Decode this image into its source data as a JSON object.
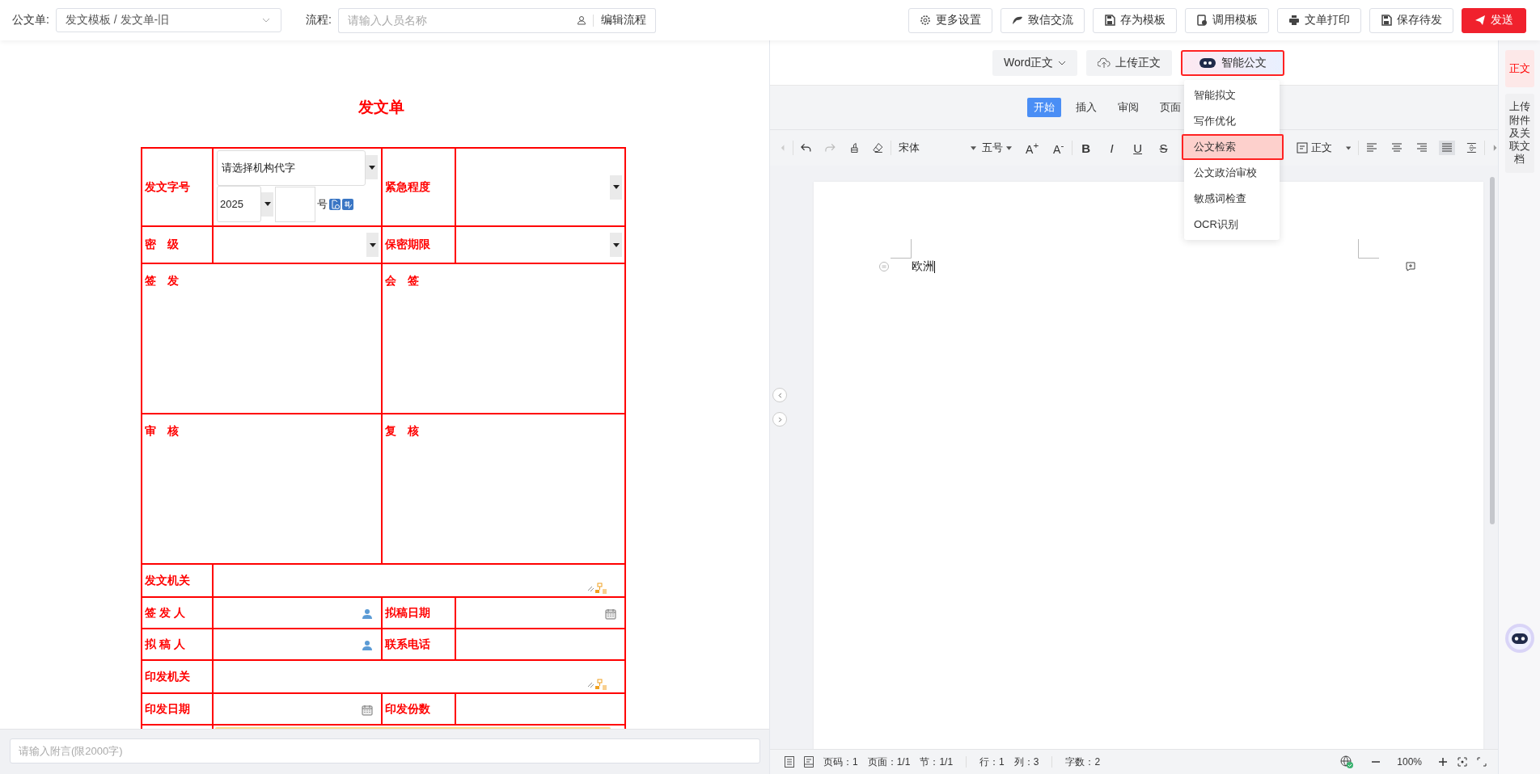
{
  "header": {
    "form_label": "公文单:",
    "form_select": "发文模板 / 发文单-旧",
    "flow_label": "流程:",
    "flow_placeholder": "请输入人员名称",
    "flow_button": "编辑流程",
    "actions": [
      {
        "label": "更多设置",
        "kind": "settings",
        "primary": false
      },
      {
        "label": "致信交流",
        "kind": "chat",
        "primary": false
      },
      {
        "label": "存为模板",
        "kind": "save",
        "primary": false
      },
      {
        "label": "调用模板",
        "kind": "template",
        "primary": false
      },
      {
        "label": "文单打印",
        "kind": "print",
        "primary": false
      },
      {
        "label": "保存待发",
        "kind": "save",
        "primary": false
      },
      {
        "label": "发送",
        "kind": "send",
        "primary": true
      }
    ]
  },
  "form": {
    "title": "发文单",
    "doc_number": {
      "label": "发文字号",
      "org_placeholder": "请选择机构代字",
      "year": "2025",
      "suffix": "号"
    },
    "urgency": {
      "label": "紧急程度"
    },
    "secrecy": {
      "label": "密　级"
    },
    "secrecy_term": {
      "label": "保密期限"
    },
    "opinions": [
      [
        {
          "label": "签　发"
        },
        {
          "label": "会　签"
        }
      ],
      [
        {
          "label": "审　核"
        },
        {
          "label": "复　核"
        }
      ]
    ],
    "rows": [
      {
        "kind": "wide",
        "label": "发文机关"
      },
      {
        "kind": "pair",
        "cells": [
          {
            "label": "签 发 人",
            "kind": "person"
          },
          {
            "label": "拟稿日期",
            "kind": "date"
          }
        ]
      },
      {
        "kind": "pair",
        "cells": [
          {
            "label": "拟 稿 人",
            "kind": "person"
          },
          {
            "label": "联系电话",
            "kind": "text"
          }
        ]
      },
      {
        "kind": "wide",
        "label": "印发机关"
      },
      {
        "kind": "pair",
        "cells": [
          {
            "label": "印发日期",
            "kind": "date"
          },
          {
            "label": "印发份数",
            "kind": "text"
          }
        ]
      }
    ]
  },
  "memo": {
    "placeholder": "请输入附言(限2000字)"
  },
  "editor": {
    "top_buttons": [
      {
        "label": "Word正文",
        "kind": "dropdown",
        "highlighted": false
      },
      {
        "label": "上传正文",
        "kind": "upload",
        "highlighted": false
      },
      {
        "label": "智能公文",
        "kind": "ai",
        "highlighted": true
      }
    ],
    "ribbon_tabs": [
      {
        "label": "开始",
        "selected": true
      },
      {
        "label": "插入",
        "selected": false
      },
      {
        "label": "审阅",
        "selected": false
      },
      {
        "label": "页面",
        "selected": false
      }
    ],
    "toolbar": {
      "font": "宋体",
      "size": "五号",
      "size_buttons": [
        "A$^{+}$",
        "A$^{-}$"
      ],
      "format_buttons": [
        {
          "label": "B",
          "kind": "bold"
        },
        {
          "label": "I",
          "kind": "italic"
        },
        {
          "label": "U",
          "kind": "underline"
        },
        {
          "label": "S",
          "kind": "strike"
        }
      ],
      "style": "正文",
      "alignment": [
        {
          "kind": "left",
          "selected": false
        },
        {
          "kind": "center",
          "selected": false
        },
        {
          "kind": "right",
          "selected": false
        },
        {
          "kind": "justify",
          "selected": true
        }
      ]
    },
    "ai_menu": [
      {
        "label": "智能拟文",
        "selected": false
      },
      {
        "label": "写作优化",
        "selected": false
      },
      {
        "label": "公文检索",
        "selected": true
      },
      {
        "label": "公文政治审校",
        "selected": false
      },
      {
        "label": "敏感词检查",
        "selected": false
      },
      {
        "label": "OCR识别",
        "selected": false
      }
    ],
    "document_text": "欧洲",
    "status": {
      "page": "页码：1",
      "pages": "页面：1/1",
      "section": "节：1/1",
      "line": "行：1",
      "column": "列：3",
      "words": "字数：2",
      "zoom": "100%"
    }
  },
  "side_rail": [
    {
      "label": "正文",
      "selected": true
    },
    {
      "label": "上传附件及关联文档",
      "selected": false
    }
  ]
}
